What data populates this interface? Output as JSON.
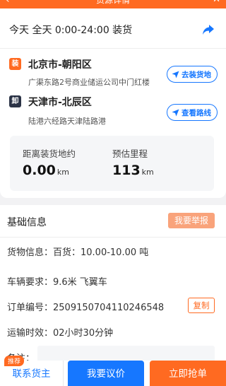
{
  "header": {
    "title": "货源详情",
    "back_icon": "back-arrow-icon",
    "close_icon": "close-icon",
    "color": "#ff6a21"
  },
  "schedule": {
    "text": "今天 全天 0:00-24:00 装货",
    "share_icon": "share-arrow-icon",
    "share_color": "#1677ff"
  },
  "route": {
    "load": {
      "tag": "装",
      "city": "北京市-朝阳区",
      "address": "广渠东路2号商业储运公司中门红楼",
      "button": "去装货地"
    },
    "unload": {
      "tag": "卸",
      "city": "天津市-北辰区",
      "address": "陆港六经路天津陆路港",
      "button": "查看路线"
    }
  },
  "distance": {
    "to_load_label": "距离装货地约",
    "to_load_value": "0.00",
    "to_load_unit": "km",
    "mileage_label": "预估里程",
    "mileage_value": "113",
    "mileage_unit": "km"
  },
  "basic_info": {
    "title": "基础信息",
    "report_button": "我要举报",
    "cargo": "货物信息：百货：10.00-10.00 吨",
    "vehicle": "车辆要求：9.6米 飞翼车",
    "order": "订单编号：2509150704110246548",
    "copy_button": "复制",
    "duration": "运输时效：02小时30分钟",
    "remark_label": "备注："
  },
  "actions": {
    "badge": "推荐",
    "contact": "联系货主",
    "negotiate": "我要议价",
    "grab": "立即抢单"
  },
  "colors": {
    "brand_orange": "#ff6a21",
    "brand_blue": "#1677ff",
    "dark_tag": "#2b3346"
  }
}
